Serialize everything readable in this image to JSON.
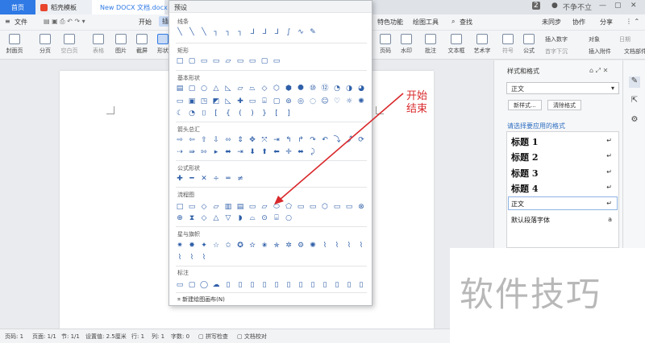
{
  "tabs": {
    "home": "首页",
    "template": "稻壳模板",
    "doc": "New DOCX 文档.docx",
    "badge": "2",
    "user": "不争不立"
  },
  "menu": {
    "file": "文件",
    "start": "开始",
    "insert": "插入",
    "special": "特色功能",
    "draw": "绘图工具",
    "search": "查找",
    "sync": "未同步",
    "collab": "协作",
    "share": "分享"
  },
  "ribbon": {
    "cover": "封面页",
    "section": "分页",
    "blank": "空白页",
    "table": "表格",
    "picture": "图片",
    "screenshot": "截屏",
    "shape": "形状",
    "page": "页码",
    "watermark": "水印",
    "comment": "批注",
    "textbox": "文本框",
    "wordart": "艺术字",
    "symbol": "符号",
    "formula": "公式",
    "insert_num": "插入数字",
    "object": "对象",
    "date": "日期",
    "dropcap": "首字下沉",
    "attach": "插入附件",
    "docpart": "文档部件"
  },
  "shapes": {
    "title": "预设",
    "lines": "线条",
    "rect": "矩形",
    "basic": "基本形状",
    "arrows": "箭头总汇",
    "formula": "公式形状",
    "flow": "流程图",
    "stars": "星与旗帜",
    "callout": "标注",
    "new_canvas": "新建绘图画布(N)"
  },
  "taskpane": {
    "title": "样式和格式",
    "current": "正文",
    "new_style": "新样式...",
    "clear": "清除格式",
    "pick": "请选择要应用的格式",
    "styles": [
      "标题 1",
      "标题 2",
      "标题 3",
      "标题 4",
      "正文",
      "默认段落字体"
    ]
  },
  "status": {
    "page": "页码: 1",
    "pages": "页面: 1/1",
    "section": "节: 1/1",
    "setting": "设置值: 2.5厘米",
    "row": "行: 1",
    "col": "列: 1",
    "words": "字数: 0",
    "spell": "拼写检查",
    "proof": "文档校对"
  },
  "annotation": {
    "line1": "开始",
    "line2": "结束"
  },
  "watermark": "软件技巧"
}
